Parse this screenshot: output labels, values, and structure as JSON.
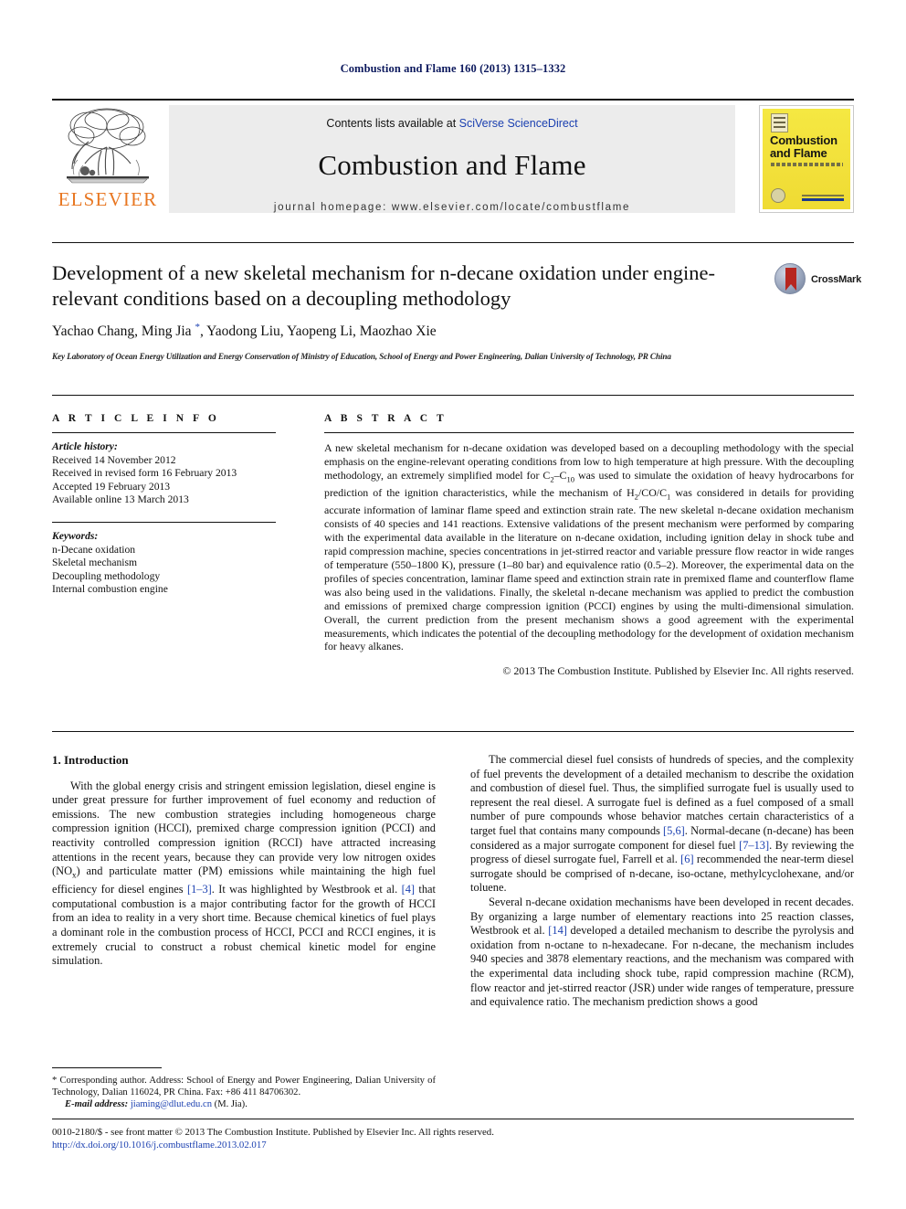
{
  "running_head": "Combustion and Flame 160 (2013) 1315–1332",
  "masthead": {
    "publisher_wordmark": "ELSEVIER",
    "contents_prefix": "Contents lists available at ",
    "contents_link": "SciVerse ScienceDirect",
    "journal_name": "Combustion and Flame",
    "homepage": "journal homepage: www.elsevier.com/locate/combustflame",
    "cover_title_line1": "Combustion",
    "cover_title_line2": "and Flame"
  },
  "article": {
    "title": "Development of a new skeletal mechanism for n-decane oxidation under engine-relevant conditions based on a decoupling methodology",
    "crossmark_label": "CrossMark",
    "authors": "Yachao Chang, Ming Jia *, Yaodong Liu, Yaopeng Li, Maozhao Xie",
    "affiliation": "Key Laboratory of Ocean Energy Utilization and Energy Conservation of Ministry of Education, School of Energy and Power Engineering, Dalian University of Technology, PR China"
  },
  "info": {
    "heading": "A R T I C L E    I N F O",
    "history_label": "Article history:",
    "history": [
      "Received 14 November 2012",
      "Received in revised form 16 February 2013",
      "Accepted 19 February 2013",
      "Available online 13 March 2013"
    ],
    "keywords_label": "Keywords:",
    "keywords": [
      "n-Decane oxidation",
      "Skeletal mechanism",
      "Decoupling methodology",
      "Internal combustion engine"
    ]
  },
  "abstract": {
    "heading": "A B S T R A C T",
    "paragraph_html": "A new skeletal mechanism for n-decane oxidation was developed based on a decoupling methodology with the special emphasis on the engine-relevant operating conditions from low to high temperature at high pressure. With the decoupling methodology, an extremely simplified model for C<sub>2</sub>&ndash;C<sub>10</sub> was used to simulate the oxidation of heavy hydrocarbons for prediction of the ignition characteristics, while the mechanism of H<sub>2</sub>/CO/C<sub>1</sub> was considered in details for providing accurate information of laminar flame speed and extinction strain rate. The new skeletal n-decane oxidation mechanism consists of 40 species and 141 reactions. Extensive validations of the present mechanism were performed by comparing with the experimental data available in the literature on n-decane oxidation, including ignition delay in shock tube and rapid compression machine, species concentrations in jet-stirred reactor and variable pressure flow reactor in wide ranges of temperature (550&ndash;1800 K), pressure (1&ndash;80 bar) and equivalence ratio (0.5&ndash;2). Moreover, the experimental data on the profiles of species concentration, laminar flame speed and extinction strain rate in premixed flame and counterflow flame was also being used in the validations. Finally, the skeletal n-decane mechanism was applied to predict the combustion and emissions of premixed charge compression ignition (PCCI) engines by using the multi-dimensional simulation. Overall, the current prediction from the present mechanism shows a good agreement with the experimental measurements, which indicates the potential of the decoupling methodology for the development of oxidation mechanism for heavy alkanes.",
    "copyright": "© 2013 The Combustion Institute. Published by Elsevier Inc. All rights reserved."
  },
  "body": {
    "section_heading": "1. Introduction",
    "left_paragraphs_html": [
      "With the global energy crisis and stringent emission legislation, diesel engine is under great pressure for further improvement of fuel economy and reduction of emissions. The new combustion strategies including homogeneous charge compression ignition (HCCI), premixed charge compression ignition (PCCI) and reactivity controlled compression ignition (RCCI) have attracted increasing attentions in the recent years, because they can provide very low nitrogen oxides (NO<sub>x</sub>) and particulate matter (PM) emissions while maintaining the high fuel efficiency for diesel engines <span class=\"ref\">[1&ndash;3]</span>. It was highlighted by Westbrook et al. <span class=\"ref\">[4]</span> that computational combustion is a major contributing factor for the growth of HCCI from an idea to reality in a very short time. Because chemical kinetics of fuel plays a dominant role in the combustion process of HCCI, PCCI and RCCI engines, it is extremely crucial to construct a robust chemical kinetic model for engine simulation."
    ],
    "right_paragraphs_html": [
      "The commercial diesel fuel consists of hundreds of species, and the complexity of fuel prevents the development of a detailed mechanism to describe the oxidation and combustion of diesel fuel. Thus, the simplified surrogate fuel is usually used to represent the real diesel. A surrogate fuel is defined as a fuel composed of a small number of pure compounds whose behavior matches certain characteristics of a target fuel that contains many compounds <span class=\"ref\">[5,6]</span>. Normal-decane (n-decane) has been considered as a major surrogate component for diesel fuel <span class=\"ref\">[7&ndash;13]</span>. By reviewing the progress of diesel surrogate fuel, Farrell et al. <span class=\"ref\">[6]</span> recommended the near-term diesel surrogate should be comprised of n-decane, iso-octane, methylcyclohexane, and/or toluene.",
      "Several n-decane oxidation mechanisms have been developed in recent decades. By organizing a large number of elementary reactions into 25 reaction classes, Westbrook et al. <span class=\"ref\">[14]</span> developed a detailed mechanism to describe the pyrolysis and oxidation from n-octane to n-hexadecane. For n-decane, the mechanism includes 940 species and 3878 elementary reactions, and the mechanism was compared with the experimental data including shock tube, rapid compression machine (RCM), flow reactor and jet-stirred reactor (JSR) under wide ranges of temperature, pressure and equivalence ratio. The mechanism prediction shows a good"
    ]
  },
  "footnote_html": "* Corresponding author. Address: School of Energy and Power Engineering, Dalian University of Technology, Dalian 116024, PR China. Fax: +86 411 84706302.<br><span style=\"display:inline-block;width:14px\"></span><span class=\"em\">E-mail address:</span> <a href=\"#\">jiaming@dlut.edu.cn</a> (M. Jia).",
  "bottom": {
    "issn_line": "0010-2180/$ - see front matter © 2013 The Combustion Institute. Published by Elsevier Inc. All rights reserved.",
    "doi_link": "http://dx.doi.org/10.1016/j.combustflame.2013.02.017"
  },
  "colors": {
    "link": "#1a3fb0",
    "running_head": "#0d1a5e",
    "elsevier_orange": "#E87722",
    "cover_yellow": "#f2e03a",
    "crossmark_red": "#b7261f"
  }
}
